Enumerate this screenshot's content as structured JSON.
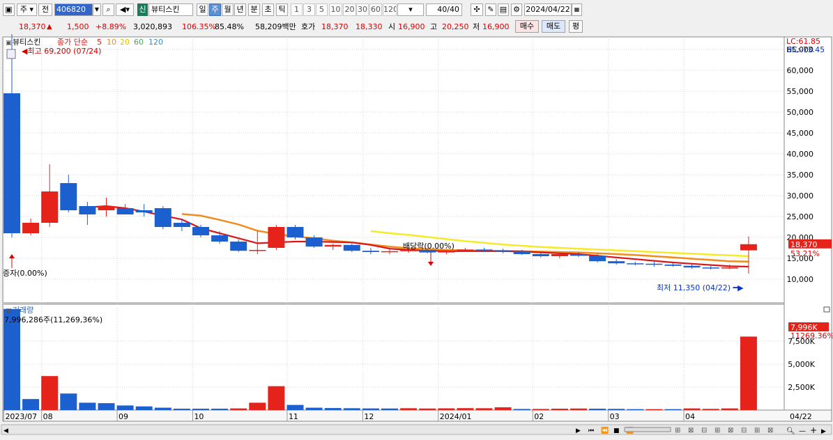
{
  "toolbar": {
    "market": "주",
    "prev_label": "전",
    "code": "406820",
    "new_badge": "신",
    "name": "뷰티스킨",
    "periods": [
      "일",
      "주",
      "월",
      "년",
      "분",
      "초",
      "틱"
    ],
    "active_period": "주",
    "numbers": [
      "1",
      "3",
      "5",
      "10",
      "20",
      "30",
      "60",
      "120"
    ],
    "count": "40",
    "count_total": "/40",
    "date": "2024/04/22"
  },
  "quote": {
    "price": "18,370",
    "change": "1,500",
    "pct": "+8.89%",
    "volume": "3,020,893",
    "vol_ratio": "106.35%",
    "turnover": "85.48%",
    "amount": "58,209백만",
    "bid_label": "호가",
    "ask": "18,370",
    "bid": "18,330",
    "open_label": "시",
    "open": "16,900",
    "high_label": "고",
    "high": "20,250",
    "low_label": "저",
    "low": "16,900",
    "buy_label": "매수",
    "sell_label": "매도",
    "avg_label": "평"
  },
  "colors": {
    "up": "#e5231b",
    "down": "#1c5fcf",
    "ma5": "#d81818",
    "ma10": "#f08c1e",
    "ma20": "#f5ea2a",
    "ma60": "#4aa05a",
    "ma120": "#3b88c8"
  },
  "chart_data": {
    "type": "candlestick",
    "price_panel": {
      "name": "뷰티스킨",
      "legend": [
        "종가 단순",
        "5",
        "10",
        "20",
        "60",
        "120"
      ],
      "lc": "LC:61.85",
      "hc": "HC:-73.45",
      "y_ticks": [
        "65,000",
        "60,000",
        "55,000",
        "50,000",
        "45,000",
        "40,000",
        "35,000",
        "30,000",
        "25,000",
        "20,000",
        "15,000",
        "10,000"
      ],
      "ylim": [
        8000,
        72000
      ],
      "current_price_label": "18,370",
      "current_pct_label": "53.21%",
      "high_annotation": "최고 69,200 (07/24)",
      "low_annotation": "최저 11,350 (04/22)",
      "dividend_annotation": "배당락(0.00%)",
      "issue_annotation": "증자(0.00%)",
      "candles": [
        {
          "o": 54500,
          "h": 69200,
          "l": 20000,
          "c": 21000
        },
        {
          "o": 21000,
          "h": 24500,
          "l": 20500,
          "c": 23500
        },
        {
          "o": 23500,
          "h": 37500,
          "l": 22500,
          "c": 31000
        },
        {
          "o": 33000,
          "h": 35000,
          "l": 26000,
          "c": 26500
        },
        {
          "o": 27500,
          "h": 28500,
          "l": 23000,
          "c": 25500
        },
        {
          "o": 26500,
          "h": 29500,
          "l": 25000,
          "c": 27500
        },
        {
          "o": 27000,
          "h": 28000,
          "l": 25500,
          "c": 25500
        },
        {
          "o": 26500,
          "h": 28000,
          "l": 25000,
          "c": 26000
        },
        {
          "o": 27000,
          "h": 27500,
          "l": 22000,
          "c": 22500
        },
        {
          "o": 23500,
          "h": 24500,
          "l": 21500,
          "c": 22500
        },
        {
          "o": 22500,
          "h": 23000,
          "l": 20000,
          "c": 20500
        },
        {
          "o": 20500,
          "h": 21500,
          "l": 18500,
          "c": 19000
        },
        {
          "o": 19000,
          "h": 19500,
          "l": 16500,
          "c": 16800
        },
        {
          "o": 16800,
          "h": 21500,
          "l": 16000,
          "c": 17000
        },
        {
          "o": 17500,
          "h": 23000,
          "l": 17000,
          "c": 22500
        },
        {
          "o": 22500,
          "h": 23000,
          "l": 19500,
          "c": 20000
        },
        {
          "o": 20000,
          "h": 20500,
          "l": 17500,
          "c": 17800
        },
        {
          "o": 17800,
          "h": 18500,
          "l": 17000,
          "c": 18200
        },
        {
          "o": 18200,
          "h": 18500,
          "l": 16500,
          "c": 16800
        },
        {
          "o": 16800,
          "h": 17500,
          "l": 16000,
          "c": 16500
        },
        {
          "o": 16500,
          "h": 17200,
          "l": 16000,
          "c": 16700
        },
        {
          "o": 16700,
          "h": 17300,
          "l": 16300,
          "c": 17000
        },
        {
          "o": 17000,
          "h": 17400,
          "l": 16200,
          "c": 16400
        },
        {
          "o": 16400,
          "h": 17000,
          "l": 16000,
          "c": 16800
        },
        {
          "o": 16800,
          "h": 17500,
          "l": 16500,
          "c": 17100
        },
        {
          "o": 17100,
          "h": 17500,
          "l": 16500,
          "c": 16800
        },
        {
          "o": 16800,
          "h": 17300,
          "l": 16200,
          "c": 16700
        },
        {
          "o": 16700,
          "h": 17000,
          "l": 15800,
          "c": 16000
        },
        {
          "o": 16000,
          "h": 16500,
          "l": 15200,
          "c": 15500
        },
        {
          "o": 15500,
          "h": 16300,
          "l": 15000,
          "c": 16000
        },
        {
          "o": 16000,
          "h": 16500,
          "l": 15300,
          "c": 15600
        },
        {
          "o": 15600,
          "h": 16000,
          "l": 14000,
          "c": 14300
        },
        {
          "o": 14300,
          "h": 14800,
          "l": 13500,
          "c": 13800
        },
        {
          "o": 13800,
          "h": 14200,
          "l": 13300,
          "c": 13700
        },
        {
          "o": 13700,
          "h": 14200,
          "l": 13000,
          "c": 13500
        },
        {
          "o": 13500,
          "h": 14000,
          "l": 13000,
          "c": 13200
        },
        {
          "o": 13200,
          "h": 13600,
          "l": 12500,
          "c": 12800
        },
        {
          "o": 12800,
          "h": 13500,
          "l": 12300,
          "c": 12700
        },
        {
          "o": 12700,
          "h": 13500,
          "l": 12400,
          "c": 12800
        },
        {
          "o": 16900,
          "h": 20250,
          "l": 11350,
          "c": 18370
        }
      ],
      "ma5": [
        null,
        null,
        null,
        null,
        27200,
        27500,
        27000,
        26200,
        25200,
        24300,
        22200,
        21000,
        19800,
        18600,
        18800,
        19000,
        19000,
        18900,
        18800,
        18200,
        17300,
        17000,
        16800,
        16700,
        16700,
        16700,
        16700,
        16600,
        16400,
        16200,
        16000,
        15600,
        15200,
        14800,
        14400,
        14000,
        13700,
        13400,
        13100,
        13000
      ],
      "ma10": [
        null,
        null,
        null,
        null,
        null,
        null,
        null,
        null,
        null,
        25600,
        25200,
        24200,
        23100,
        21600,
        20800,
        20200,
        19800,
        19200,
        18800,
        18300,
        17800,
        17400,
        17200,
        17000,
        16900,
        16800,
        16800,
        16700,
        16600,
        16500,
        16400,
        16200,
        16000,
        15800,
        15500,
        15200,
        14900,
        14600,
        14300,
        14200
      ],
      "ma20": [
        null,
        null,
        null,
        null,
        null,
        null,
        null,
        null,
        null,
        null,
        null,
        null,
        null,
        null,
        null,
        null,
        null,
        null,
        null,
        21500,
        21000,
        20600,
        20100,
        19600,
        19100,
        18700,
        18300,
        18000,
        17700,
        17500,
        17300,
        17100,
        16900,
        16700,
        16500,
        16300,
        16100,
        15900,
        15700,
        15500
      ]
    },
    "volume_panel": {
      "name": "거래량",
      "value_label": "7,996,286주(11,269,36%)",
      "y_ticks": [
        "7,500K",
        "5,000K",
        "2,500K"
      ],
      "ylim": [
        0,
        10000000
      ],
      "current_label": "7,996K",
      "current_label2": "11269.36%",
      "values": [
        11000000,
        1200000,
        3700000,
        1800000,
        800000,
        750000,
        500000,
        400000,
        260000,
        150000,
        150000,
        150000,
        180000,
        800000,
        2600000,
        560000,
        260000,
        220000,
        200000,
        180000,
        170000,
        200000,
        170000,
        190000,
        210000,
        200000,
        300000,
        120000,
        120000,
        150000,
        170000,
        150000,
        130000,
        100000,
        100000,
        100000,
        180000,
        130000,
        180000,
        7996286
      ],
      "volume_colors": [
        "down",
        "down",
        "up",
        "down",
        "down",
        "down",
        "down",
        "down",
        "down",
        "down",
        "down",
        "down",
        "up",
        "up",
        "up",
        "down",
        "down",
        "down",
        "down",
        "down",
        "down",
        "up",
        "up",
        "up",
        "up",
        "up",
        "up",
        "down",
        "up",
        "up",
        "up",
        "down",
        "down",
        "down",
        "up",
        "down",
        "up",
        "up",
        "up",
        "up"
      ]
    },
    "x_labels": [
      {
        "label": "2023/07",
        "i": 0
      },
      {
        "label": "08",
        "i": 2
      },
      {
        "label": "09",
        "i": 6
      },
      {
        "label": "10",
        "i": 10
      },
      {
        "label": "11",
        "i": 15
      },
      {
        "label": "12",
        "i": 19
      },
      {
        "label": "2024/01",
        "i": 23
      },
      {
        "label": "02",
        "i": 28
      },
      {
        "label": "03",
        "i": 32
      },
      {
        "label": "04",
        "i": 36
      }
    ],
    "x_right_label": "04/22"
  }
}
